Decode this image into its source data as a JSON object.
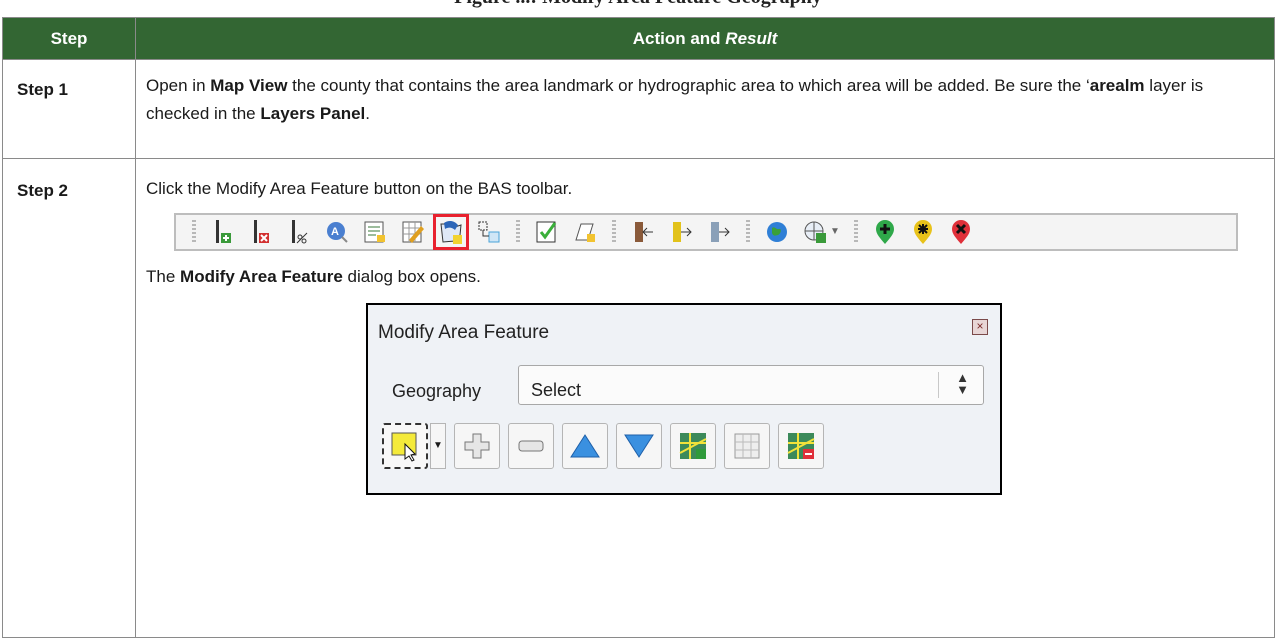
{
  "caption": "Figure ...: Modify Area Feature Geography",
  "table": {
    "header_step": "Step",
    "header_action_plain": "Action and ",
    "header_action_italic": "Result"
  },
  "step1": {
    "label": "Step 1",
    "t1": "Open in ",
    "b1": "Map View",
    "t2": " the county that contains the area landmark or hydrographic area to which area will be added. Be sure the ‘",
    "b2": "arealm",
    "t3": " layer is checked in the ",
    "b3": "Layers Panel",
    "t4": "."
  },
  "step2": {
    "label": "Step 2",
    "instruction": "Click the Modify Area Feature button on the BAS toolbar.",
    "result_t1": "The ",
    "result_b1": "Modify Area Feature",
    "result_t2": " dialog box opens."
  },
  "toolbar_icons": [
    "add-linear-feature-icon",
    "delete-linear-feature-icon",
    "split-linear-feature-icon",
    "search-feature-icon",
    "attribute-table-icon",
    "edit-attributes-icon",
    "modify-area-feature-icon",
    "boundary-change-icon",
    "validate-icon",
    "new-area-icon",
    "export-left-icon",
    "export-right-icon",
    "export-north-icon",
    "globe-icon",
    "add-web-layer-icon",
    "add-point-icon",
    "modify-point-icon",
    "delete-point-icon"
  ],
  "dialog": {
    "title": "Modify Area Feature",
    "close_glyph": "×",
    "geography_label": "Geography",
    "geography_value": "Select",
    "select_arrows": "▲▼"
  },
  "colors": {
    "header_bg": "#336633",
    "highlight": "#e8212e"
  }
}
